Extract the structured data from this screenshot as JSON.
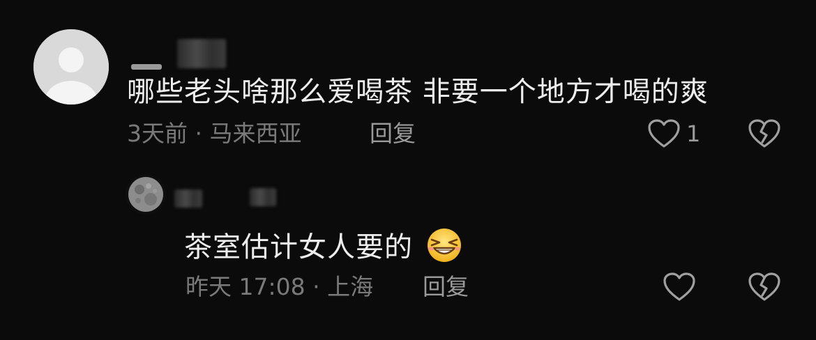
{
  "comments": [
    {
      "text": "哪些老头啥那么爱喝茶 非要一个地方才喝的爽",
      "time": "3天前",
      "separator": "·",
      "location": "马来西亚",
      "reply_label": "回复",
      "like_count": "1",
      "avatar": "default-avatar-icon",
      "name_redacted": true
    }
  ],
  "replies": [
    {
      "text": "茶室估计女人要的",
      "emoji": "grinning-squint-emoji",
      "time": "昨天 17:08",
      "separator": "·",
      "location": "上海",
      "reply_label": "回复",
      "avatar": "moon-avatar",
      "name_redacted": true
    }
  ],
  "colors": {
    "background": "#0b0b0b",
    "text": "#ededed",
    "meta": "#7a7a7a",
    "icon": "#a0a0a0"
  }
}
